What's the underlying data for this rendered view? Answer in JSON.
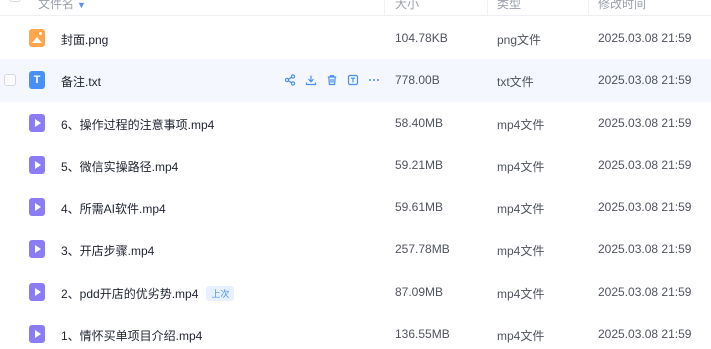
{
  "header": {
    "name_col": "文件名",
    "size_col": "大小",
    "type_col": "类型",
    "date_col": "修改时间"
  },
  "colors": {
    "accent": "#4a8ff6",
    "hover_row": "#f4f7fe",
    "video_icon": "#8b7cf6",
    "image_icon": "#ffa64d"
  },
  "files": [
    {
      "name": "封面.png",
      "size": "104.78KB",
      "type": "png文件",
      "modified": "2025.03.08 21:59",
      "icon": "image-file-icon"
    },
    {
      "name": "备注.txt",
      "size": "778.00B",
      "type": "txt文件",
      "modified": "2025.03.08 21:59",
      "icon": "text-file-icon",
      "icon_letter": "T"
    },
    {
      "name": "6、操作过程的注意事项.mp4",
      "size": "58.40MB",
      "type": "mp4文件",
      "modified": "2025.03.08 21:59",
      "icon": "video-file-icon"
    },
    {
      "name": "5、微信实操路径.mp4",
      "size": "59.21MB",
      "type": "mp4文件",
      "modified": "2025.03.08 21:59",
      "icon": "video-file-icon"
    },
    {
      "name": "4、所需AI软件.mp4",
      "size": "59.61MB",
      "type": "mp4文件",
      "modified": "2025.03.08 21:59",
      "icon": "video-file-icon"
    },
    {
      "name": "3、开店步骤.mp4",
      "size": "257.78MB",
      "type": "mp4文件",
      "modified": "2025.03.08 21:59",
      "icon": "video-file-icon"
    },
    {
      "name": "2、pdd开店的优劣势.mp4",
      "size": "87.09MB",
      "type": "mp4文件",
      "modified": "2025.03.08 21:59",
      "icon": "video-file-icon",
      "tag": "上次"
    },
    {
      "name": "1、情怀买单项目介绍.mp4",
      "size": "136.55MB",
      "type": "mp4文件",
      "modified": "2025.03.08 21:59",
      "icon": "video-file-icon"
    }
  ],
  "row_actions": [
    "share-icon",
    "download-icon",
    "delete-icon",
    "details-icon",
    "more-icon"
  ]
}
